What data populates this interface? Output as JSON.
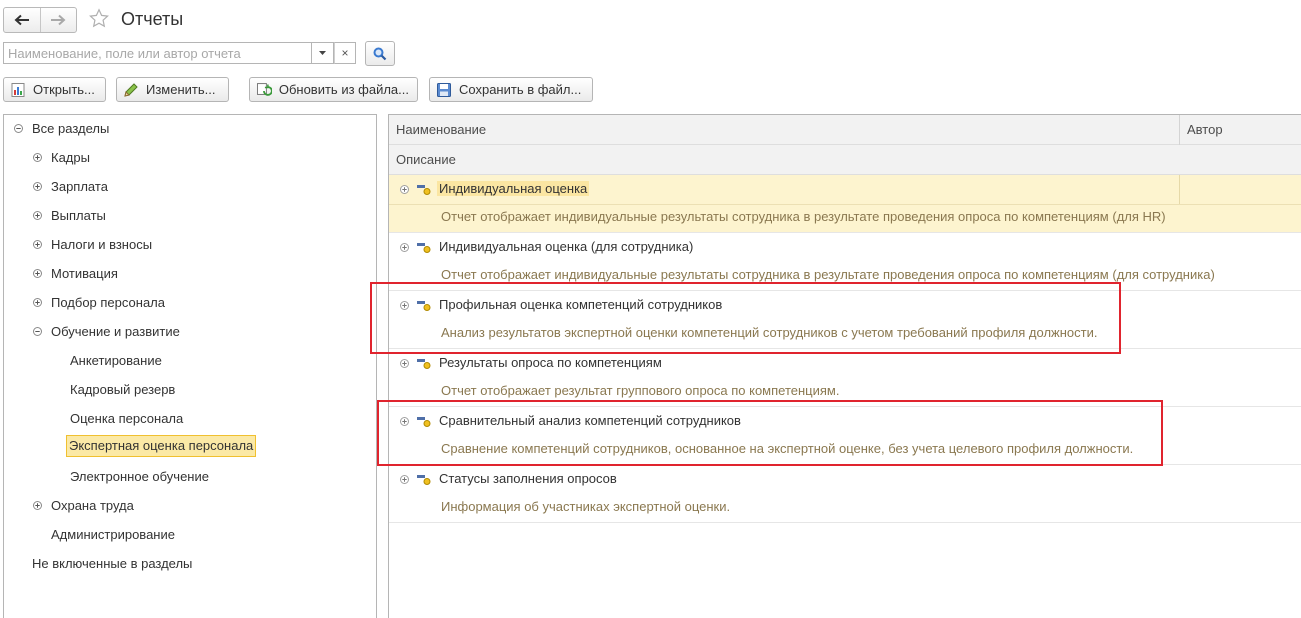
{
  "header": {
    "title": "Отчеты"
  },
  "search": {
    "placeholder": "Наименование, поле или автор отчета",
    "clear_glyph": "×"
  },
  "toolbar": {
    "open_label": "Открыть...",
    "edit_label": "Изменить...",
    "update_label": "Обновить из файла...",
    "save_label": "Сохранить в файл..."
  },
  "tree": {
    "root": "Все разделы",
    "sections": [
      "Кадры",
      "Зарплата",
      "Выплаты",
      "Налоги и взносы",
      "Мотивация",
      "Подбор персонала",
      "Обучение и развитие"
    ],
    "subsections": [
      "Анкетирование",
      "Кадровый резерв",
      "Оценка персонала",
      "Экспертная оценка персонала",
      "Электронное обучение"
    ],
    "after": [
      "Охрана труда",
      "Администрирование"
    ],
    "not_included": "Не включенные в разделы",
    "selected": "Экспертная оценка персонала"
  },
  "table": {
    "col_name": "Наименование",
    "col_author": "Автор",
    "col_description": "Описание",
    "rows": [
      {
        "name": "Индивидуальная оценка",
        "desc": "Отчет отображает индивидуальные результаты сотрудника в результате проведения опроса по компетенциям (для HR)"
      },
      {
        "name": "Индивидуальная оценка (для сотрудника)",
        "desc": "Отчет отображает индивидуальные результаты сотрудника в результате проведения опроса по компетенциям (для сотрудника)"
      },
      {
        "name": "Профильная оценка компетенций сотрудников",
        "desc": "Анализ результатов экспертной оценки компетенций сотрудников с учетом требований профиля должности."
      },
      {
        "name": "Результаты опроса по компетенциям",
        "desc": "Отчет отображает результат группового опроса по компетенциям."
      },
      {
        "name": "Сравнительный анализ компетенций сотрудников",
        "desc": "Сравнение компетенций сотрудников, основанное на экспертной оценке, без учета целевого профиля должности."
      },
      {
        "name": "Статусы заполнения опросов",
        "desc": "Информация об участниках экспертной оценки."
      }
    ]
  },
  "colors": {
    "selection_bg": "#fbe9a6",
    "selection_border": "#f0c030",
    "active_row_bg": "#fdf4cf",
    "description_text": "#8a7850",
    "highlight_box": "#e0242e"
  }
}
